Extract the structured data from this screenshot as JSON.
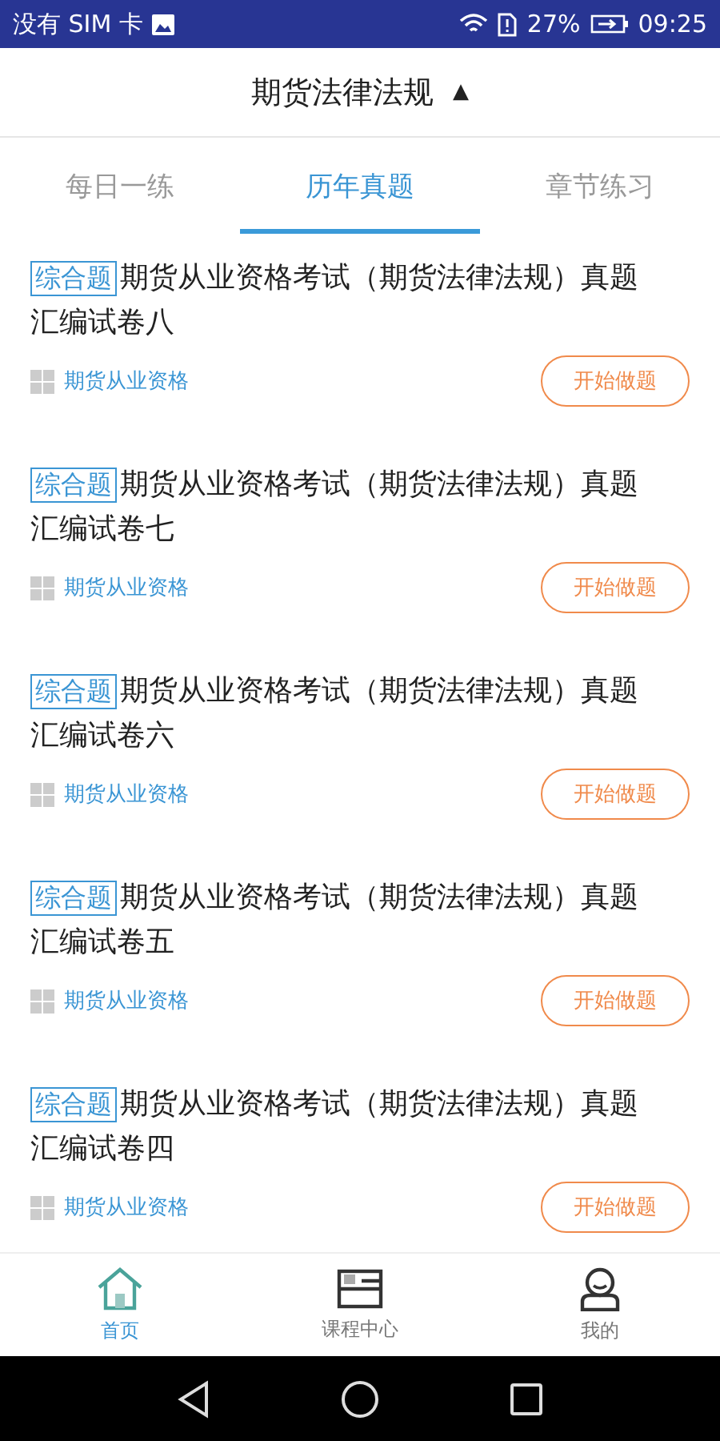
{
  "status_bar": {
    "carrier": "没有 SIM 卡",
    "battery": "27%",
    "time": "09:25"
  },
  "header": {
    "title": "期货法律法规",
    "caret": "▲"
  },
  "tabs": [
    {
      "label": "每日一练",
      "selected": false
    },
    {
      "label": "历年真题",
      "selected": true
    },
    {
      "label": "章节练习",
      "selected": false
    }
  ],
  "papers": [
    {
      "tag": "综合题",
      "title_lines": [
        "期货从业资格考试（期货法律法规）真题",
        "汇编试卷八"
      ],
      "category": "期货从业资格",
      "action": "开始做题"
    },
    {
      "tag": "综合题",
      "title_lines": [
        "期货从业资格考试（期货法律法规）真题",
        "汇编试卷七"
      ],
      "category": "期货从业资格",
      "action": "开始做题"
    },
    {
      "tag": "综合题",
      "title_lines": [
        "期货从业资格考试（期货法律法规）真题",
        "汇编试卷六"
      ],
      "category": "期货从业资格",
      "action": "开始做题"
    },
    {
      "tag": "综合题",
      "title_lines": [
        "期货从业资格考试（期货法律法规）真题",
        "汇编试卷五"
      ],
      "category": "期货从业资格",
      "action": "开始做题"
    },
    {
      "tag": "综合题",
      "title_lines": [
        "期货从业资格考试（期货法律法规）真题",
        "汇编试卷四"
      ],
      "category": "期货从业资格",
      "action": "开始做题"
    }
  ],
  "bottom_nav": [
    {
      "label": "首页",
      "kind": "home",
      "selected": true
    },
    {
      "label": "课程中心",
      "kind": "course",
      "selected": false
    },
    {
      "label": "我的",
      "kind": "profile",
      "selected": false
    }
  ]
}
